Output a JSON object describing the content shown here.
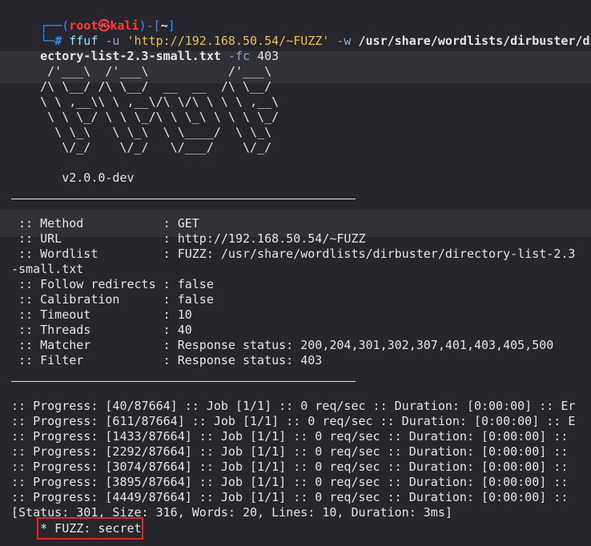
{
  "prompt": {
    "deco_top": "┌──(",
    "user": "root㉿kali",
    "sep": ")-[",
    "path": "~",
    "close": "]",
    "deco_bottom": "└─",
    "hash": "#"
  },
  "command": {
    "program": "ffuf",
    "flag_u": "-u",
    "url": "'http://192.168.50.54/~FUZZ'",
    "flag_w": "-w",
    "wordlist_part1": "/usr/share/wordlists/dirbuster/dir",
    "wordlist_part2": "ectory-list-2.3-small.txt",
    "flag_fc": "-fc",
    "fc_value": "403"
  },
  "banner": [
    "     /'___\\  /'___\\           /'___\\",
    "    /\\ \\__/ /\\ \\__/  __  __  /\\ \\__/",
    "    \\ \\ ,__\\\\ \\ ,__\\/\\ \\/\\ \\ \\ \\ ,__\\",
    "     \\ \\ \\_/ \\ \\ \\_/\\ \\ \\_\\ \\ \\ \\ \\_/",
    "      \\ \\_\\   \\ \\_\\  \\ \\____/  \\ \\_\\",
    "       \\/_/    \\/_/   \\/___/    \\/_/"
  ],
  "version": "       v2.0.0-dev",
  "config": [
    " :: Method           : GET",
    " :: URL              : http://192.168.50.54/~FUZZ",
    " :: Wordlist         : FUZZ: /usr/share/wordlists/dirbuster/directory-list-2.3",
    "-small.txt",
    " :: Follow redirects : false",
    " :: Calibration      : false",
    " :: Timeout          : 10",
    " :: Threads          : 40",
    " :: Matcher          : Response status: 200,204,301,302,307,401,403,405,500",
    " :: Filter           : Response status: 403"
  ],
  "progress": [
    ":: Progress: [40/87664] :: Job [1/1] :: 0 req/sec :: Duration: [0:00:00] :: Er",
    ":: Progress: [611/87664] :: Job [1/1] :: 0 req/sec :: Duration: [0:00:00] :: E",
    ":: Progress: [1433/87664] :: Job [1/1] :: 0 req/sec :: Duration: [0:00:00] ::",
    ":: Progress: [2292/87664] :: Job [1/1] :: 0 req/sec :: Duration: [0:00:00] ::",
    ":: Progress: [3074/87664] :: Job [1/1] :: 0 req/sec :: Duration: [0:00:00] ::",
    ":: Progress: [3895/87664] :: Job [1/1] :: 0 req/sec :: Duration: [0:00:00] ::",
    ":: Progress: [4449/87664] :: Job [1/1] :: 0 req/sec :: Duration: [0:00:00] ::"
  ],
  "result_status": "[Status: 301, Size: 316, Words: 20, Lines: 10, Duration: 3ms]",
  "result_fuzz": "    * FUZZ: secret",
  "colors": {
    "background": "#26262c",
    "prompt_blue": "#3b8eea",
    "prompt_red": "#ff3b3b",
    "highlight_red": "#e0252b"
  }
}
